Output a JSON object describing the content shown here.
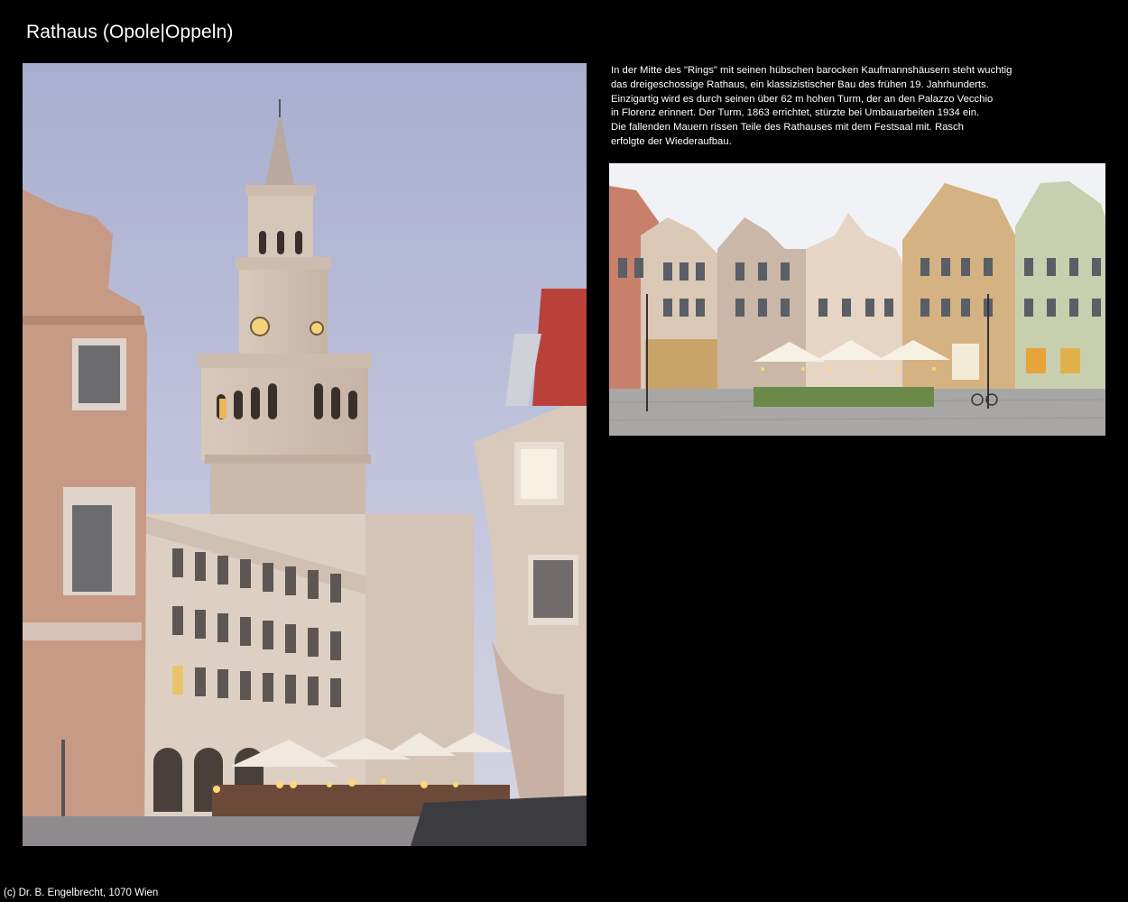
{
  "page": {
    "title": "Rathaus (Opole|Oppeln)",
    "footer": "(c) Dr. B. Engelbrecht, 1070 Wien"
  },
  "description": {
    "lines": [
      "In der Mitte des \"Rings\" mit seinen hübschen barocken Kaufmannshäusern steht wuchtig",
      "das dreigeschossige Rathaus, ein klassizistischer Bau des frühen 19. Jahrhunderts.",
      "Einzigartig wird es durch seinen über 62 m hohen Turm, der an den Palazzo Vecchio",
      "in Florenz erinnert. Der Turm, 1863 errichtet, stürzte bei Umbauarbeiten 1934 ein.",
      "Die fallenden Mauern rissen Teile des Rathauses mit dem Festsaal mit. Rasch",
      "erfolgte der Wiederaufbau."
    ]
  },
  "colors": {
    "background": "#000000",
    "text": "#ffffff",
    "sky_dusk": "#b9bdd6",
    "facade_beige": "#e2d4c4",
    "facade_pink": "#c99c86"
  }
}
